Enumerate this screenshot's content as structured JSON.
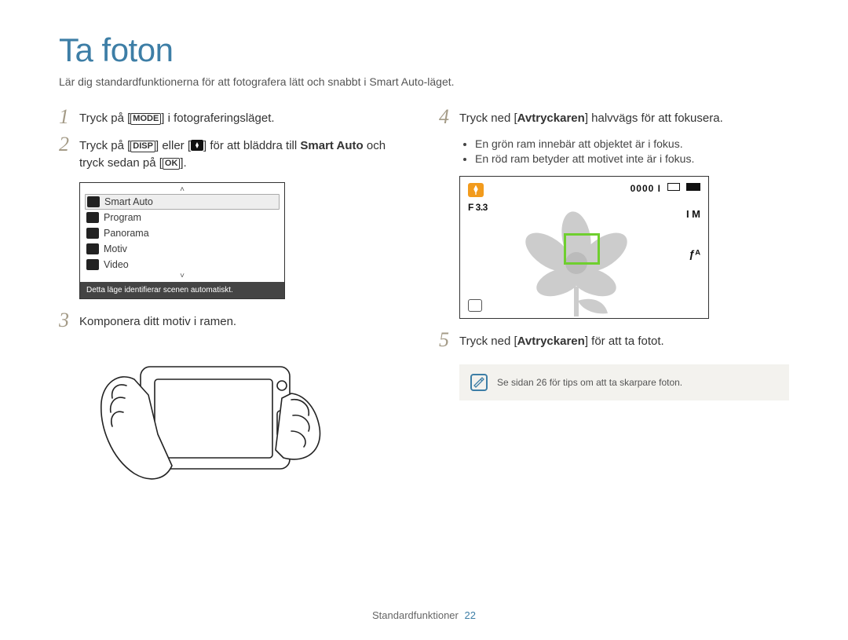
{
  "page": {
    "title": "Ta foton",
    "subtitle": "Lär dig standardfunktionerna för att fotografera lätt och snabbt i Smart Auto-läget."
  },
  "steps": {
    "s1": {
      "num": "1",
      "prefix": "Tryck på [",
      "btn": "MODE",
      "suffix": "] i fotograferingsläget."
    },
    "s2": {
      "num": "2",
      "t1": "Tryck på [",
      "btn1": "DISP",
      "t2": "] eller [",
      "t3": "] för att bläddra till ",
      "bold": "Smart Auto",
      "t4": " och tryck sedan på [",
      "btn2": "OK",
      "t5": "]."
    },
    "s3": {
      "num": "3",
      "text": "Komponera ditt motiv i ramen."
    },
    "s4": {
      "num": "4",
      "t1": "Tryck ned [",
      "bold": "Avtryckaren",
      "t2": "] halvvägs för att fokusera.",
      "b1": "En grön ram innebär att objektet är i fokus.",
      "b2": "En röd ram betyder att motivet inte är i fokus."
    },
    "s5": {
      "num": "5",
      "t1": "Tryck ned [",
      "bold": "Avtryckaren",
      "t2": "] för att ta fotot."
    }
  },
  "mode_screen": {
    "items": [
      "Smart Auto",
      "Program",
      "Panorama",
      "Motiv",
      "Video"
    ],
    "caption": "Detta läge identifierar scenen automatiskt."
  },
  "viewfinder": {
    "fnum": "F 3.3",
    "count": "0000 I",
    "res": "I M",
    "flash": "ƒᴬ"
  },
  "note": {
    "text": "Se sidan 26 för tips om att ta skarpare foton."
  },
  "footer": {
    "section": "Standardfunktioner",
    "page": "22"
  }
}
